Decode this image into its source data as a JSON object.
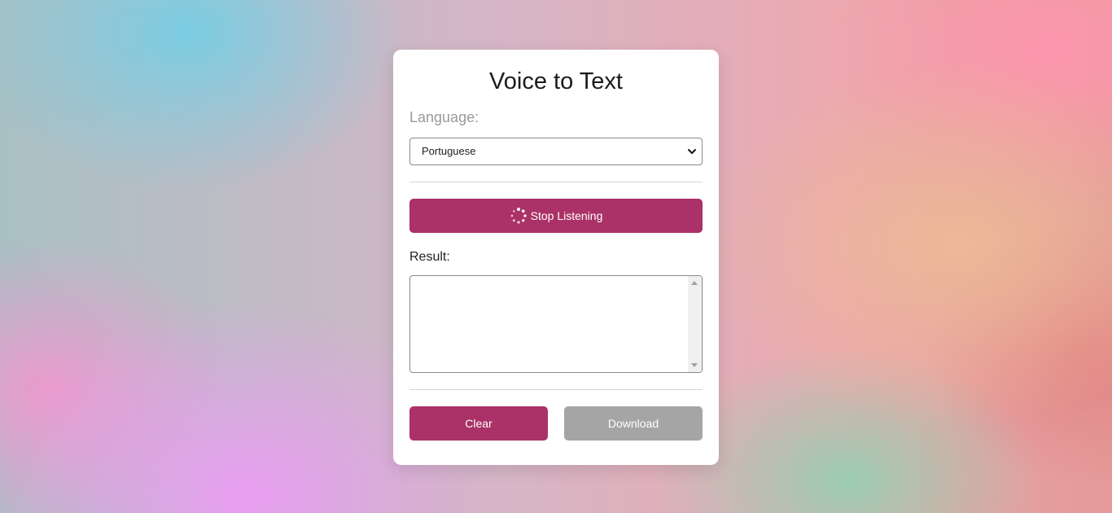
{
  "app": {
    "title": "Voice to Text"
  },
  "language": {
    "label": "Language:",
    "selected": "Portuguese"
  },
  "listen_button": {
    "label": "Stop Listening",
    "icon": "spinner-icon"
  },
  "result": {
    "label": "Result:",
    "value": ""
  },
  "actions": {
    "clear_label": "Clear",
    "download_label": "Download"
  },
  "colors": {
    "accent": "#ab3268",
    "disabled": "#a5a5a5"
  }
}
